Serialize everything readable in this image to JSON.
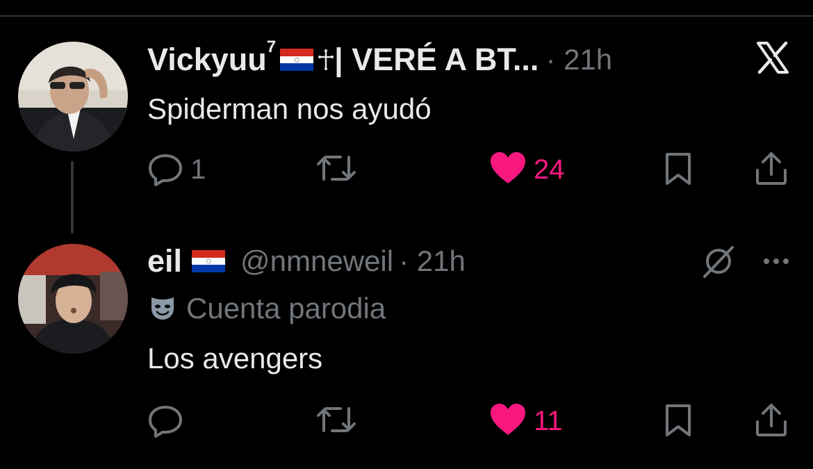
{
  "colors": {
    "background": "#000000",
    "text": "#e7e9ea",
    "muted": "#71767b",
    "like": "#f91880",
    "divider": "#2f3336"
  },
  "header": {
    "close_icon": "x-logo-icon"
  },
  "tweets": [
    {
      "name": "Vickyuu",
      "name_sup": "7",
      "name_suffix": "| VERÉ A BT...",
      "time": "· 21h",
      "text": "Spiderman nos ayudó",
      "reply_count": "1",
      "like_count": "24"
    },
    {
      "name": "eil",
      "handle": "@nmneweil",
      "time": "· 21h",
      "parody_label": "Cuenta parodia",
      "text": "Los avengers",
      "like_count": "11"
    }
  ]
}
